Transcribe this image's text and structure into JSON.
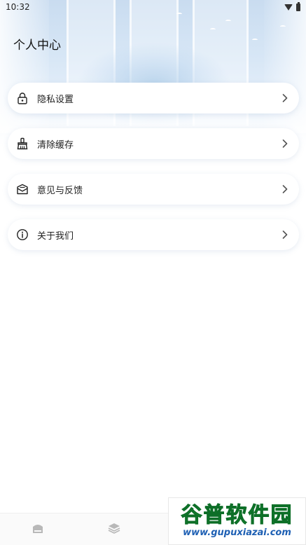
{
  "status_bar": {
    "time": "10:32",
    "wifi_icon": "wifi-icon",
    "battery_icon": "battery-icon"
  },
  "header": {
    "title": "个人中心"
  },
  "menu": [
    {
      "label": "隐私设置",
      "icon": "lock-icon"
    },
    {
      "label": "清除缓存",
      "icon": "broom-icon"
    },
    {
      "label": "意见与反馈",
      "icon": "mail-icon"
    },
    {
      "label": "关于我们",
      "icon": "info-icon"
    }
  ],
  "bottom_nav": [
    {
      "icon": "home-icon"
    },
    {
      "icon": "layers-icon"
    }
  ],
  "watermark": {
    "title": "谷普软件园",
    "url": "www.gupuxiazai.com"
  },
  "colors": {
    "accent_bg": "#d8e7f6",
    "card_bg": "#ffffff",
    "text": "#222222"
  }
}
